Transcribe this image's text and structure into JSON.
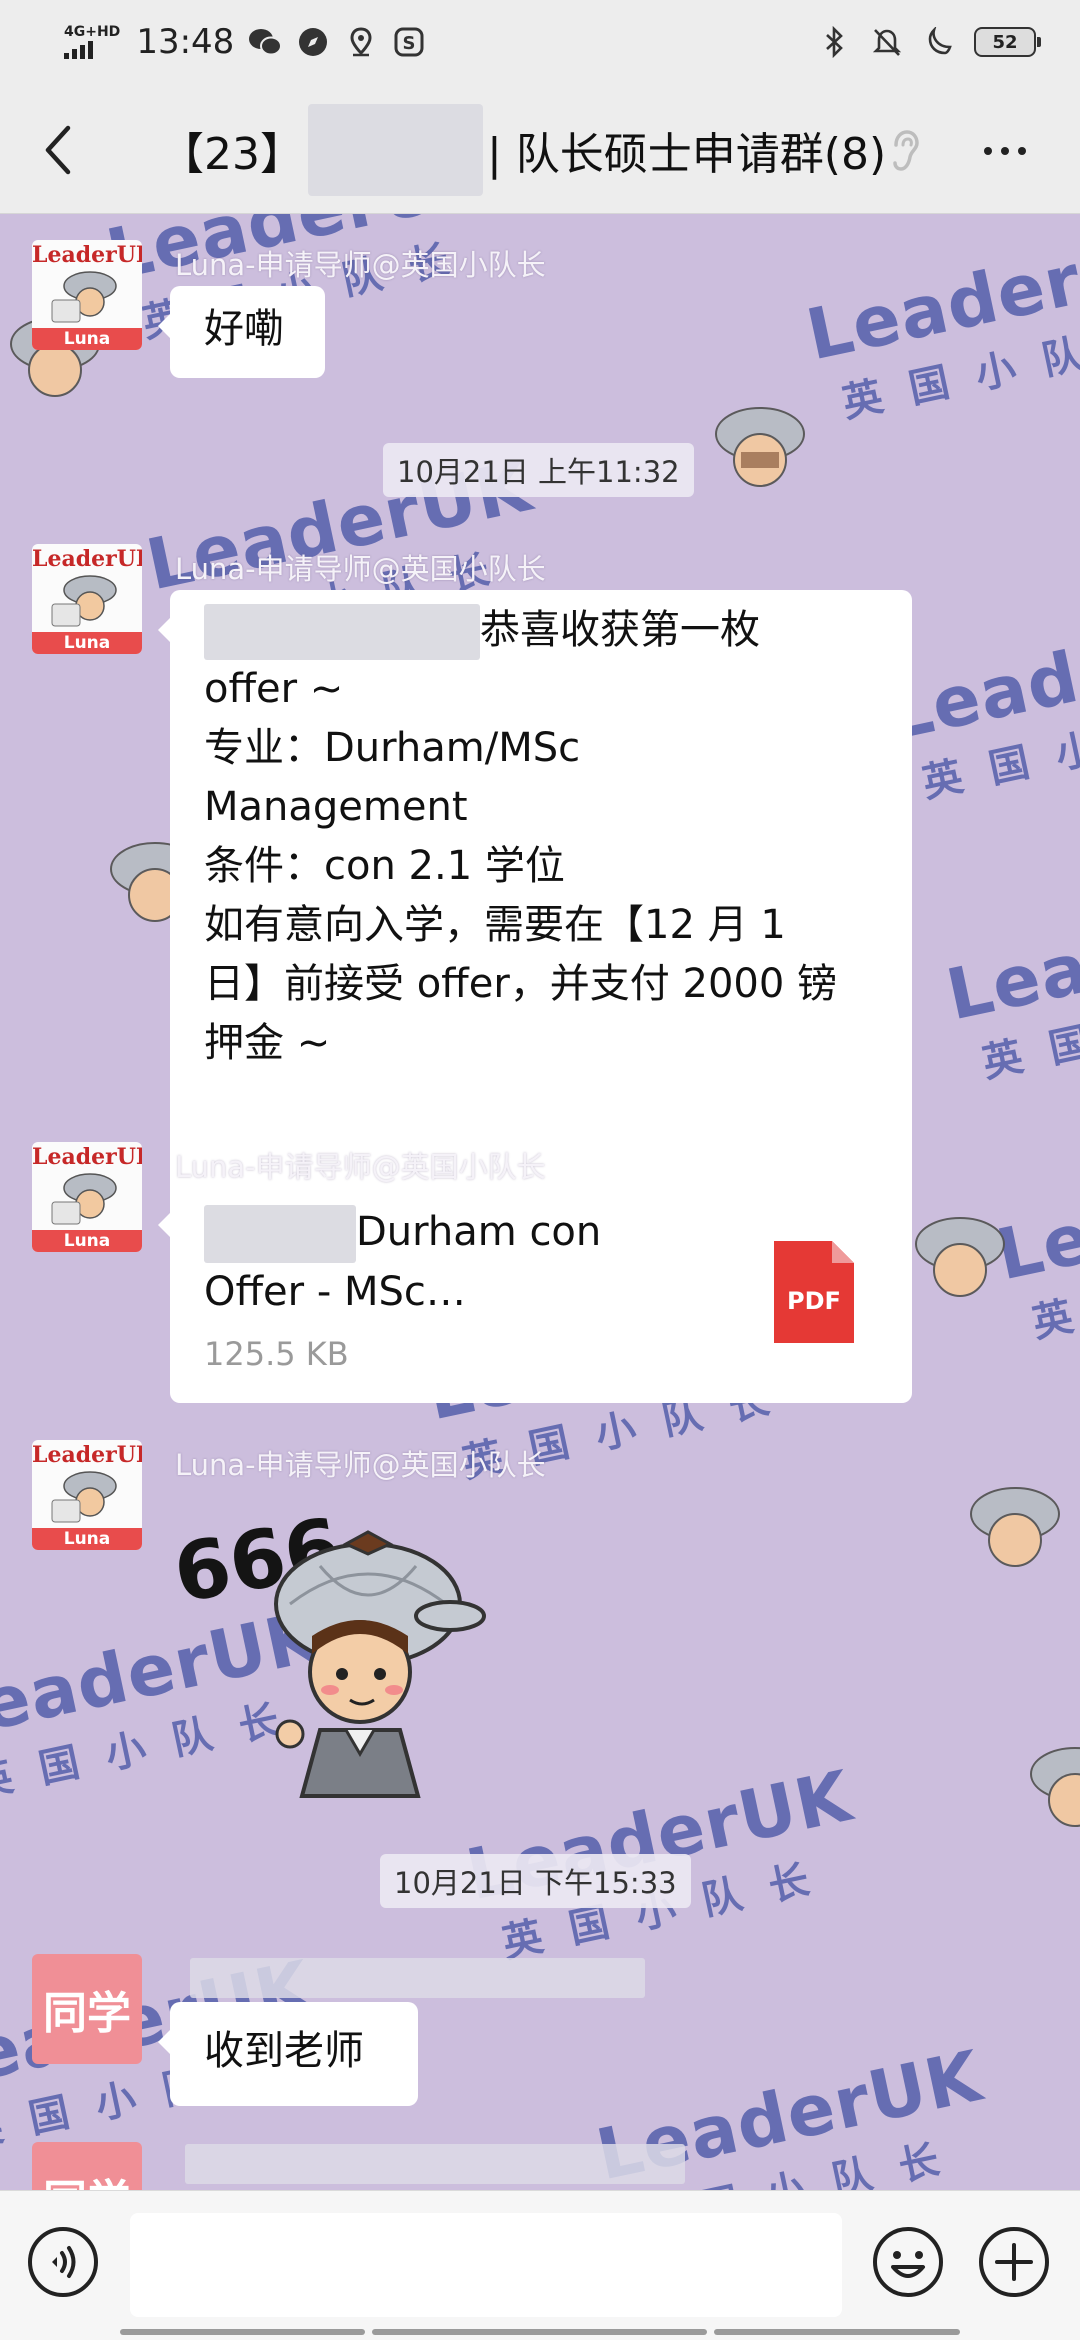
{
  "status_bar": {
    "network": "4G+HD",
    "time": "13:48",
    "battery": "52"
  },
  "header": {
    "title_prefix": "【23】",
    "title_suffix": "| 队长硕士申请群(8)"
  },
  "messages": [
    {
      "type": "text",
      "sender": "Luna-申请导师@英国小队长",
      "text": "好嘞"
    },
    {
      "type": "timestamp",
      "text": "10月21日 上午11:32"
    },
    {
      "type": "text",
      "sender": "Luna-申请导师@英国小队长",
      "lines": [
        "恭喜收获第一枚",
        "offer ~",
        "专业：Durham/MSc",
        "Management",
        "条件：con 2.1 学位",
        "如有意向入学，需要在【12 月 1",
        "日】前接受 offer，并支付 2000 镑",
        "押金 ~"
      ]
    },
    {
      "type": "file",
      "sender": "Luna-申请导师@英国小队长",
      "name_line1": "Durham con",
      "name_line2": "Offer - MSc…",
      "size": "125.5 KB",
      "file_type": "PDF"
    },
    {
      "type": "sticker",
      "sender": "Luna-申请导师@英国小队长",
      "text": "666"
    },
    {
      "type": "timestamp",
      "text": "10月21日 下午15:33"
    },
    {
      "type": "text",
      "sender_avatar": "同学",
      "text": "收到老师"
    }
  ],
  "avatar": {
    "brand": "LeaderUK",
    "name": "Luna",
    "student_label": "同学"
  },
  "watermark": {
    "brand": "LeaderUK",
    "subtitle": "英国小队长"
  },
  "colors": {
    "chat_background": "#ccbedd",
    "watermark": "#3f4fa2",
    "pdf_red": "#e53935",
    "student_avatar": "#f08f96"
  },
  "icons": [
    "back-arrow-icon",
    "ear-icon",
    "more-icon",
    "voice-icon",
    "emoji-icon",
    "plus-icon",
    "pdf-icon"
  ]
}
